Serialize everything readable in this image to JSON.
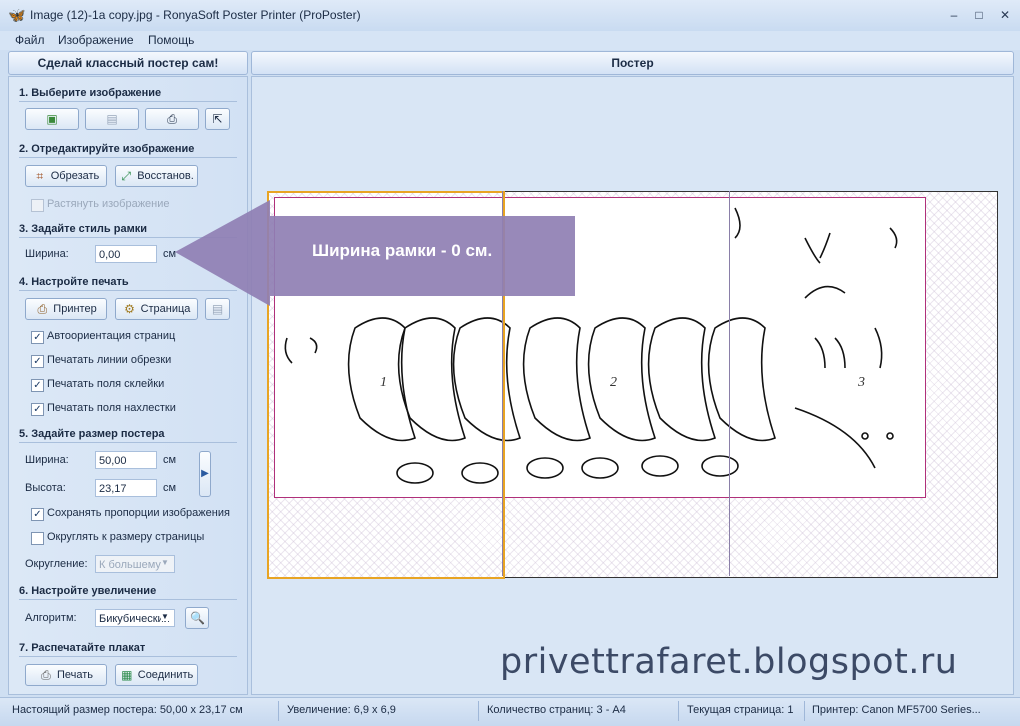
{
  "window": {
    "title": "Image (12)-1a copy.jpg - RonyaSoft Poster Printer (ProPoster)",
    "controls": {
      "minimize": "‒",
      "maximize": "□",
      "close": "✕"
    }
  },
  "menu": {
    "file": "Файл",
    "image": "Изображение",
    "help": "Помощь"
  },
  "left_panel": {
    "header": "Сделай классный постер сам!",
    "s1": {
      "title": "1. Выберите изображение"
    },
    "s2": {
      "title": "2. Отредактируйте изображение",
      "crop": "Обрезать",
      "restore": "Восстанов.",
      "stretch": "Растянуть изображение"
    },
    "s3": {
      "title": "3. Задайте стиль рамки",
      "width_label": "Ширина:",
      "width_value": "0,00",
      "unit": "см"
    },
    "s4": {
      "title": "4. Настройте печать",
      "printer": "Принтер",
      "page": "Страница",
      "auto_orient": "Автоориентация страниц",
      "cut_lines": "Печатать линии обрезки",
      "glue_margins": "Печатать поля склейки",
      "overlap_margins": "Печатать поля нахлестки"
    },
    "s5": {
      "title": "5. Задайте размер постера",
      "width_label": "Ширина:",
      "width_value": "50,00",
      "height_label": "Высота:",
      "height_value": "23,17",
      "unit": "см",
      "keep_ratio": "Сохранять пропорции изображения",
      "round_page": "Округлять к размеру страницы",
      "rounding_label": "Округление:",
      "rounding_value": "К большему"
    },
    "s6": {
      "title": "6. Настройте увеличение",
      "algo_label": "Алгоритм:",
      "algo_value": "Бикубический"
    },
    "s7": {
      "title": "7. Распечатайте плакат",
      "print": "Печать",
      "join": "Соединить"
    }
  },
  "preview": {
    "header": "Постер",
    "page_numbers": [
      "1",
      "2",
      "3"
    ],
    "callout": "Ширина рамки - 0 см.",
    "watermark": "privettrafaret.blogspot.ru"
  },
  "status": {
    "size": "Настоящий размер постера: 50,00 x 23,17 см",
    "zoom": "Увеличение: 6,9 x 6,9",
    "pages": "Количество страниц: 3 - A4",
    "current": "Текущая страница: 1",
    "printer": "Принтер: Canon MF5700 Series..."
  },
  "colors": {
    "accent_orange": "#e8a423",
    "callout_purple": "#8f7fb3",
    "print_area": "#b0307a"
  }
}
